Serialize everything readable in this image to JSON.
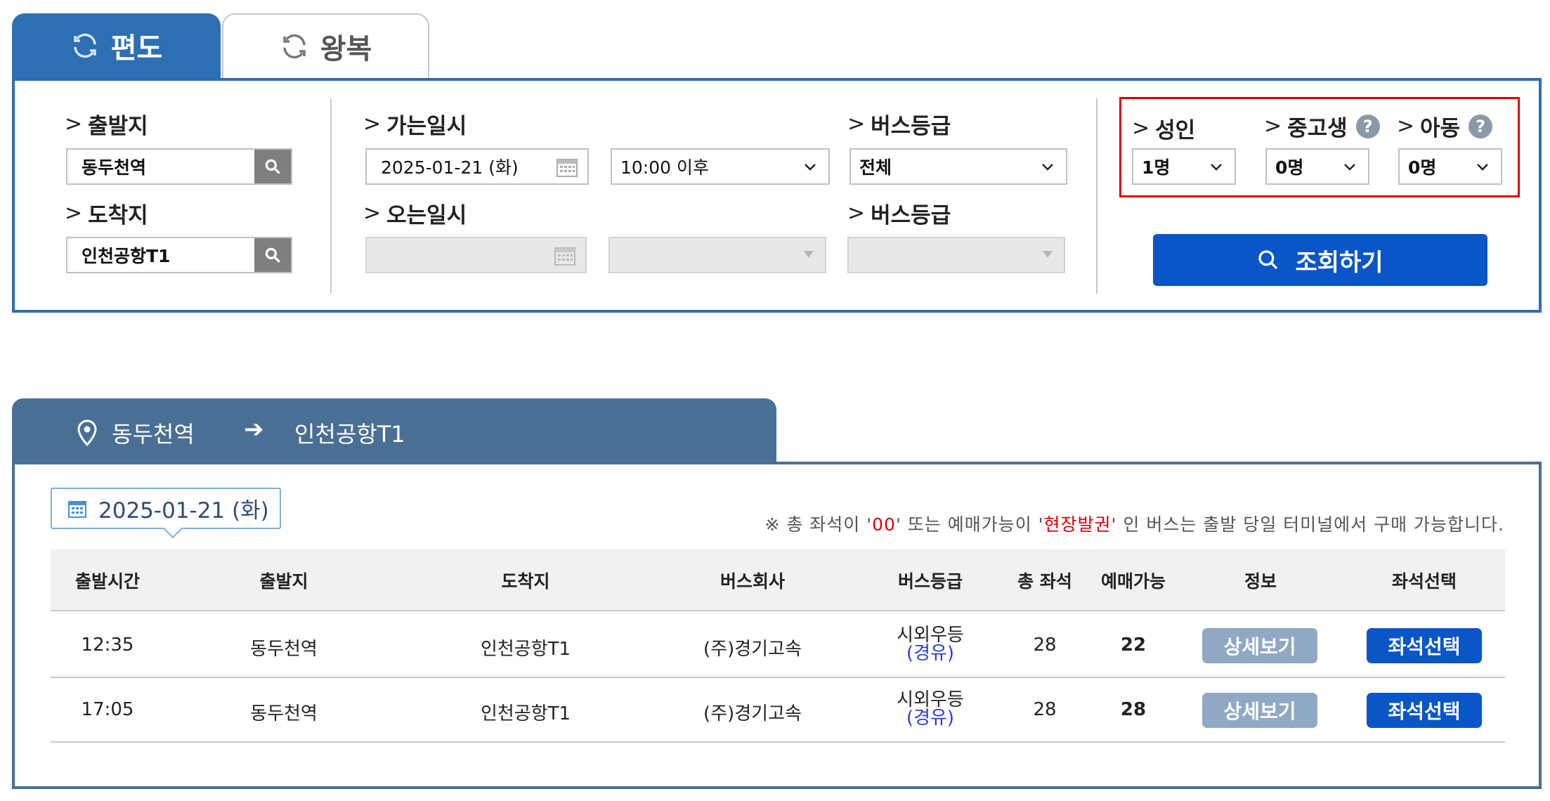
{
  "tabs": {
    "oneway": "편도",
    "roundtrip": "왕복"
  },
  "search": {
    "departure_label": "출발지",
    "departure_value": "동두천역",
    "arrival_label": "도착지",
    "arrival_value": "인천공항T1",
    "go_date_label": "가는일시",
    "go_date_value": "2025-01-21 (화)",
    "go_time_value": "10:00 이후",
    "go_grade_label": "버스등급",
    "go_grade_value": "전체",
    "return_date_label": "오는일시",
    "return_grade_label": "버스등급",
    "adult_label": "성인",
    "adult_value": "1명",
    "teen_label": "중고생",
    "teen_value": "0명",
    "child_label": "아동",
    "child_value": "0명",
    "query_button": "조회하기"
  },
  "route": {
    "from": "동두천역",
    "arrow": "➔",
    "to": "인천공항T1"
  },
  "results": {
    "date": "2025-01-21 (화)",
    "notice_prefix": "※ 총 좌석이 '",
    "notice_red1": "00",
    "notice_mid": "' 또는 예매가능이 '",
    "notice_red2": "현장발권",
    "notice_suffix": "' 인 버스는 출발 당일 터미널에서 구매 가능합니다.",
    "columns": [
      "출발시간",
      "출발지",
      "도착지",
      "버스회사",
      "버스등급",
      "총 좌석",
      "예매가능",
      "정보",
      "좌석선택"
    ],
    "rows": [
      {
        "time": "12:35",
        "from": "동두천역",
        "to": "인천공항T1",
        "company": "(주)경기고속",
        "grade": "시외우등",
        "via": "(경유)",
        "total": "28",
        "available": "22",
        "detail": "상세보기",
        "seat": "좌석선택"
      },
      {
        "time": "17:05",
        "from": "동두천역",
        "to": "인천공항T1",
        "company": "(주)경기고속",
        "grade": "시외우등",
        "via": "(경유)",
        "total": "28",
        "available": "28",
        "detail": "상세보기",
        "seat": "좌석선택"
      }
    ]
  },
  "colors": {
    "primary_blue": "#2e6eb2",
    "button_blue": "#0a56c8",
    "route_blue": "#4a6f94",
    "highlight_red": "#e10000",
    "detail_button": "#8fa9c4"
  },
  "icons": [
    "refresh-icon",
    "search-icon",
    "calendar-icon",
    "chevron-down-icon",
    "help-icon",
    "location-pin-icon"
  ]
}
